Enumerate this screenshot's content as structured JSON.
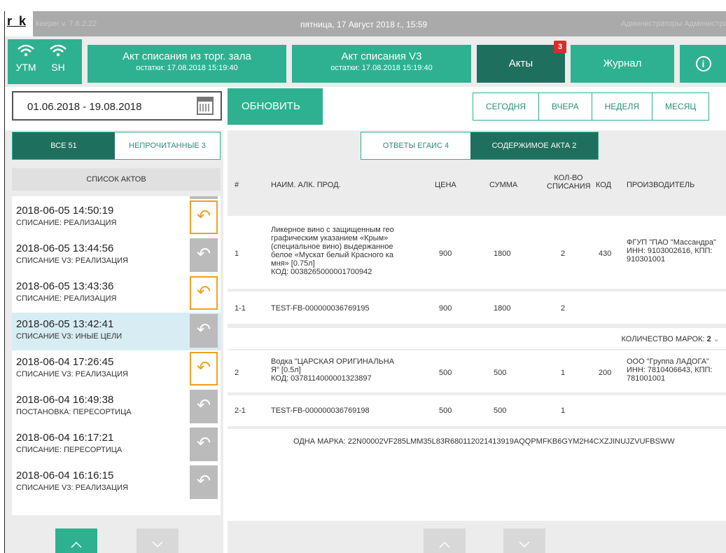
{
  "titlebar": {
    "logo": "r_k",
    "version": "keeper v. 7.6.2.22",
    "datetime": "пятница, 17 Август 2018 г., 15:59",
    "user": "Администраторы Администратор"
  },
  "header": {
    "signals": [
      {
        "label": "УТМ"
      },
      {
        "label": "SH"
      }
    ],
    "buttons": [
      {
        "title": "Акт списания из торг. зала",
        "subtitle": "остатки: 17.08.2018 15:19:40"
      },
      {
        "title": "Акт списания V3",
        "subtitle": "остатки: 17.08.2018 15:19:40"
      },
      {
        "title": "Акты",
        "badge": "3"
      },
      {
        "title": "Журнал"
      },
      {
        "title": "i"
      }
    ]
  },
  "filters": {
    "date_range": "01.06.2018 - 19.08.2018",
    "refresh_label": "ОБНОВИТЬ",
    "periods": [
      "СЕГОДНЯ",
      "ВЧЕРА",
      "НЕДЕЛЯ",
      "МЕСЯЦ"
    ]
  },
  "left": {
    "tab_all": "ВСЕ  51",
    "tab_unread": "НЕПРОЧИТАННЫЕ  3",
    "list_title": "СПИСОК АКТОВ",
    "acts": [
      {
        "date": "2018-06-05  14:50:19",
        "type": "СПИСАНИЕ: РЕАЛИЗАЦИЯ",
        "reply": "orange"
      },
      {
        "date": "2018-06-05  13:44:56",
        "type": "СПИСАНИЕ V3: РЕАЛИЗАЦИЯ",
        "reply": "gray"
      },
      {
        "date": "2018-06-05  13:43:36",
        "type": "СПИСАНИЕ: РЕАЛИЗАЦИЯ",
        "reply": "orange"
      },
      {
        "date": "2018-06-05  13:42:41",
        "type": "СПИСАНИЕ V3: ИНЫЕ ЦЕЛИ",
        "reply": "gray",
        "selected": true
      },
      {
        "date": "2018-06-04  17:26:45",
        "type": "СПИСАНИЕ V3: РЕАЛИЗАЦИЯ",
        "reply": "orange"
      },
      {
        "date": "2018-06-04  16:49:38",
        "type": "ПОСТАНОВКА: ПЕРЕСОРТИЦА",
        "reply": "gray"
      },
      {
        "date": "2018-06-04  16:17:21",
        "type": "СПИСАНИЕ: ПЕРЕСОРТИЦА",
        "reply": "gray"
      },
      {
        "date": "2018-06-04  16:16:15",
        "type": "СПИСАНИЕ V3: РЕАЛИЗАЦИЯ",
        "reply": "gray"
      }
    ]
  },
  "right": {
    "tab_egais": "ОТВЕТЫ ЕГАИС  4",
    "tab_content": "СОДЕРЖИМОЕ АКТА  2",
    "columns": {
      "num": "#",
      "name": "НАИМ. АЛК. ПРОД.",
      "price": "ЦЕНА",
      "sum": "СУММА",
      "qty_1": "КОЛ-ВО",
      "qty_2": "СПИСАНИЯ",
      "code": "КОД",
      "producer": "ПРОИЗВОДИТЕЛЬ"
    },
    "rows": [
      {
        "num": "1",
        "name_lines": [
          "Ликерное вино с защищенным гео",
          "графическим  указанием  «Крым»",
          "(специальное вино) выдержанное",
          "белое «Мускат белый Красного ка",
          "мня»  [0.75л]",
          "КОД: 0038265000001700942"
        ],
        "price": "900",
        "sum": "1800",
        "qty": "2",
        "code": "430",
        "producer_lines": [
          "ФГУП \"ПАО \"Массандра\"",
          "ИНН: 9103002616, КПП:",
          "910301001"
        ]
      },
      {
        "num": "1-1",
        "name": "TEST-FB-000000036769195",
        "price": "900",
        "sum": "1800",
        "qty": "2"
      },
      {
        "num": "2",
        "name_lines": [
          "Водка  \"ЦАРСКАЯ ОРИГИНАЛЬНА",
          "Я\"  [0.5л]",
          "КОД: 0378114000001323897"
        ],
        "price": "500",
        "sum": "500",
        "qty": "1",
        "code": "200",
        "producer_lines": [
          "ООО \"Группа ЛАДОГА\"",
          "ИНН: 7810406643, КПП:",
          "781001001"
        ]
      },
      {
        "num": "2-1",
        "name": "TEST-FB-000000036769198",
        "price": "500",
        "sum": "500",
        "qty": "1"
      }
    ],
    "marks_count_label": "КОЛИЧЕСТВО МАРОК:",
    "marks_count_value": "2",
    "one_mark": "ОДНА МАРКА: 22N00002VF285LMM35L83R680112021413919AQQPMFKB6GYM2H4CXZJINUJZVUFBSWW"
  }
}
